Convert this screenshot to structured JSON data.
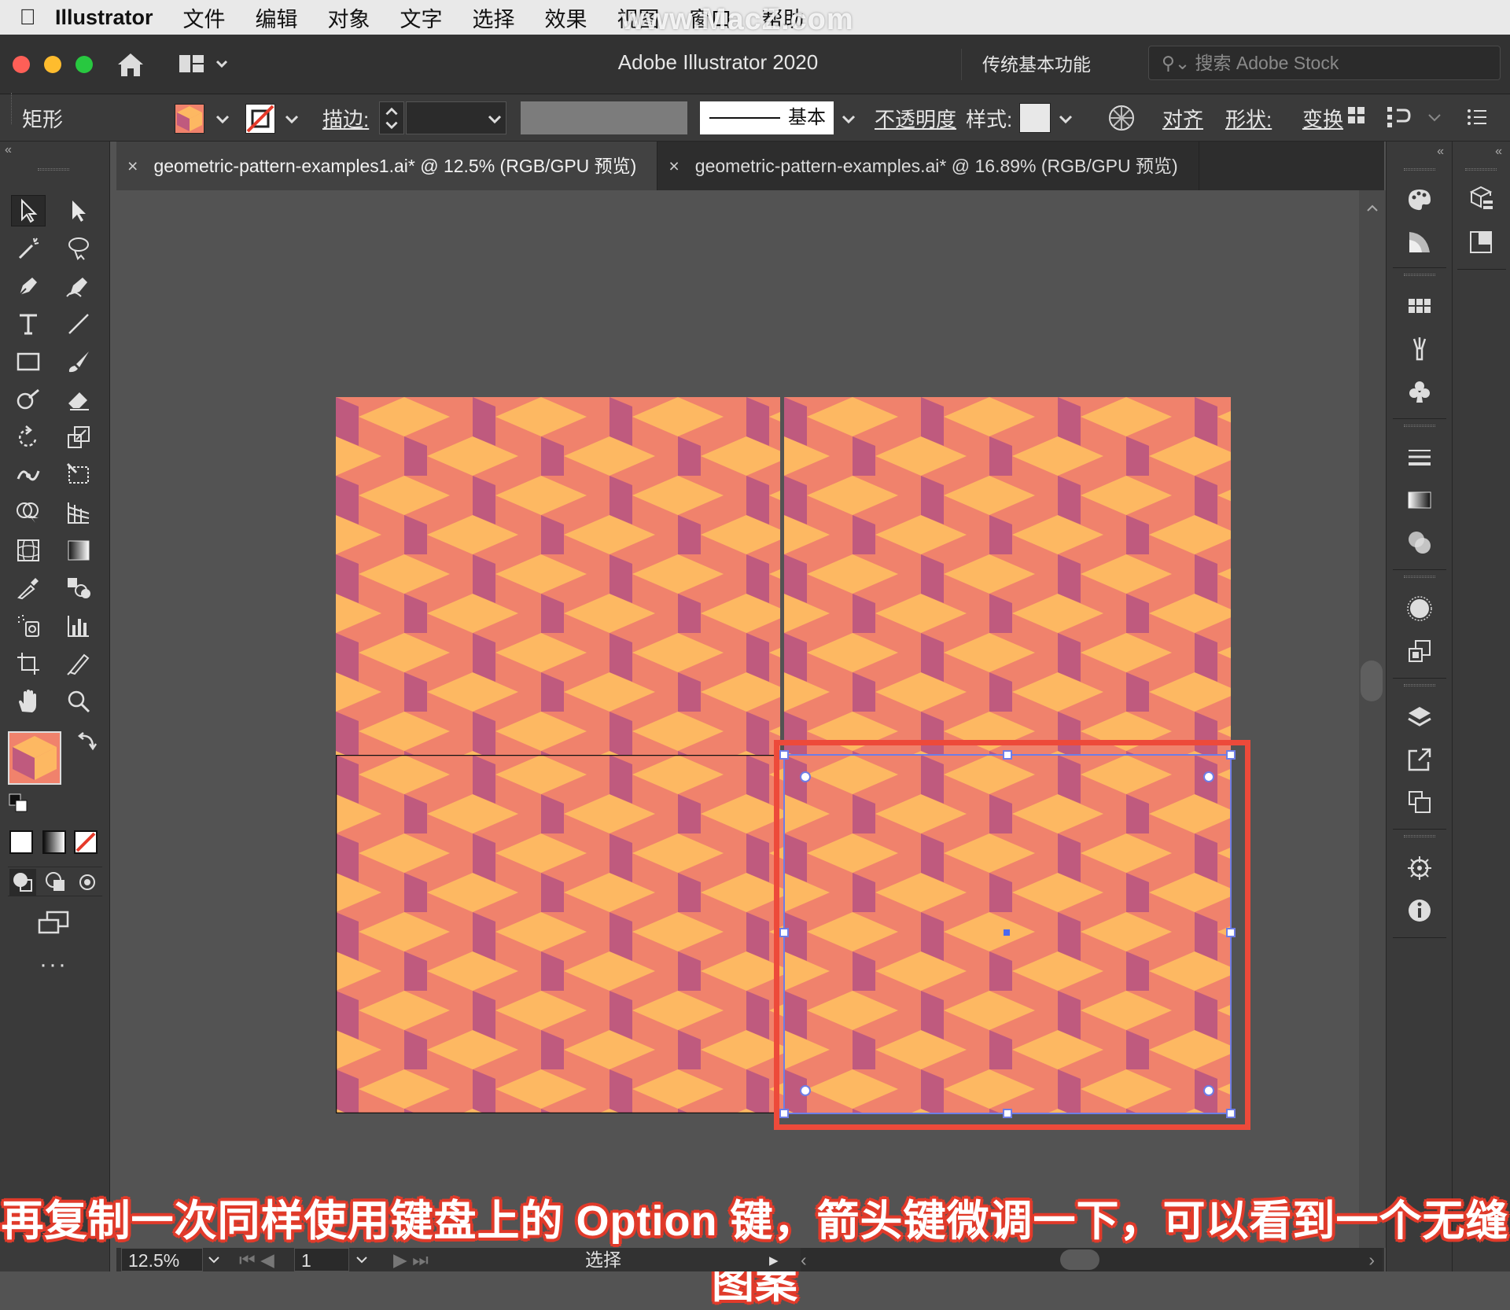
{
  "menubar": {
    "app": "Illustrator",
    "items": [
      "文件",
      "编辑",
      "对象",
      "文字",
      "选择",
      "效果",
      "视图",
      "窗口",
      "帮助"
    ]
  },
  "watermark": "www.MacZ.com",
  "titlebar": {
    "title": "Adobe Illustrator 2020",
    "workspace": "传统基本功能",
    "search_placeholder": "搜索 Adobe Stock"
  },
  "control": {
    "object_type": "矩形",
    "stroke_label": "描边:",
    "profile_label": "基本",
    "opacity_label": "不透明度",
    "style_label": "样式:",
    "align_label": "对齐",
    "shape_label": "形状:",
    "transform_label": "变换"
  },
  "tabs": [
    {
      "label": "geometric-pattern-examples1.ai* @ 12.5% (RGB/GPU 预览)",
      "active": true
    },
    {
      "label": "geometric-pattern-examples.ai* @ 16.89% (RGB/GPU 预览)",
      "active": false
    }
  ],
  "caption": "再复制一次同样使用键盘上的 Option 键，箭头键微调一下，可以看到一个无缝图案",
  "status": {
    "zoom": "12.5%",
    "page": "1",
    "tool": "选择"
  },
  "colors": {
    "pattern_bg": "#f0826c",
    "pattern_light": "#fdb862",
    "pattern_dark": "#bf5a7e",
    "selection": "#ed4a3a",
    "selection_frame": "#6e7de6"
  }
}
